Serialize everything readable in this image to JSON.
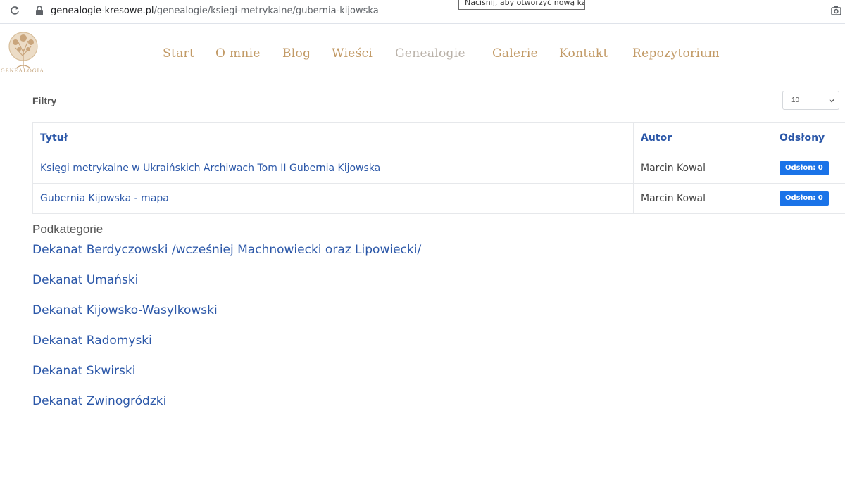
{
  "browser": {
    "url_domain": "genealogie-kresowe.pl",
    "url_path": "/genealogie/ksiegi-metrykalne/gubernia-kijowska",
    "tooltip": "Naciśnij, aby otworzyć nową kartę"
  },
  "site": {
    "logo_text": "GENEALOGIA",
    "nav": [
      "Start",
      "O mnie",
      "Blog",
      "Wieści",
      "Genealogie",
      "Galerie",
      "Kontakt",
      "Repozytorium"
    ],
    "active_nav": "Genealogie",
    "colors": {
      "nav": "#c29a66",
      "nav_active": "#b9b1a8",
      "link": "#2b57a8",
      "badge": "#1a73e8"
    }
  },
  "filters": {
    "label": "Filtry",
    "page_size": "10"
  },
  "table": {
    "headers": [
      "Tytuł",
      "Autor",
      "Odsłony"
    ],
    "rows": [
      {
        "title": "Księgi metrykalne w Ukraińskich Archiwach Tom II Gubernia Kijowska",
        "author": "Marcin Kowal",
        "views": "Odsłon: 0"
      },
      {
        "title": "Gubernia Kijowska - mapa",
        "author": "Marcin Kowal",
        "views": "Odsłon: 0"
      }
    ]
  },
  "subcategories": {
    "heading": "Podkategorie",
    "items": [
      "Dekanat Berdyczowski /wcześniej Machnowiecki oraz Lipowiecki/",
      "Dekanat Umański",
      "Dekanat Kijowsko-Wasylkowski",
      "Dekanat Radomyski",
      "Dekanat Skwirski",
      "Dekanat Zwinogródzki"
    ]
  }
}
